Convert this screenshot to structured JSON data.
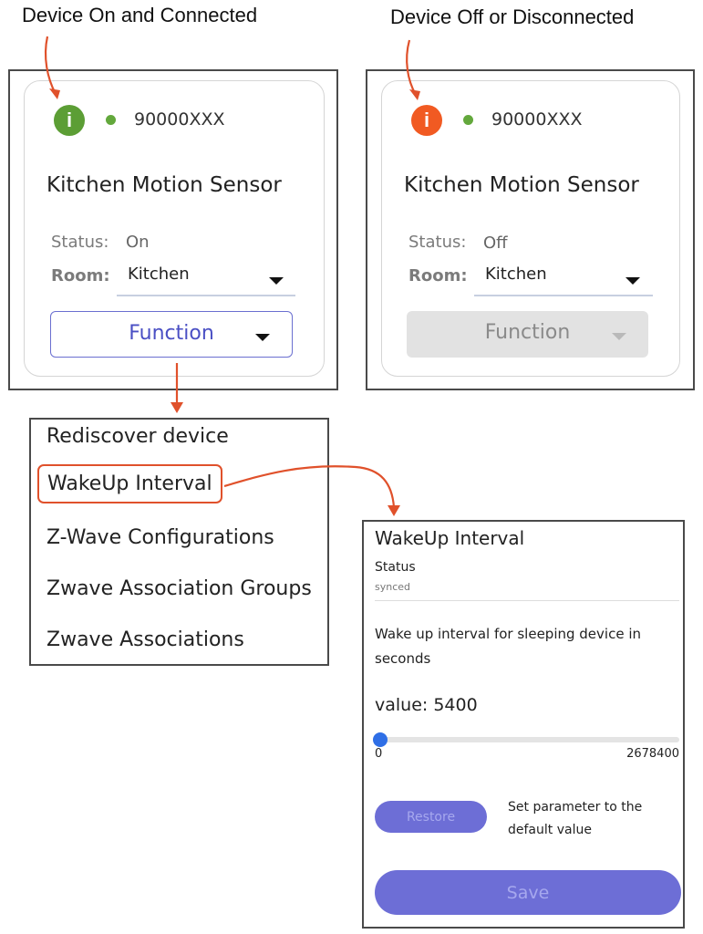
{
  "captions": {
    "left": "Device On and Connected",
    "right": "Device Off or Disconnected"
  },
  "card_on": {
    "info_icon": "info-icon",
    "info_glyph": "i",
    "icon_color": "#5c9e35",
    "connection_dot_color": "#63a83c",
    "device_id": "90000XXX",
    "device_name": "Kitchen Motion Sensor",
    "status_label": "Status:",
    "status_value": "On",
    "room_label": "Room:",
    "room_value": "Kitchen",
    "function_label": "Function"
  },
  "card_off": {
    "info_icon": "info-icon",
    "info_glyph": "i",
    "icon_color": "#f15a22",
    "connection_dot_color": "#63a83c",
    "device_id": "90000XXX",
    "device_name": "Kitchen Motion Sensor",
    "status_label": "Status:",
    "status_value": "Off",
    "room_label": "Room:",
    "room_value": "Kitchen",
    "function_label": "Function"
  },
  "function_menu": {
    "items": [
      "Rediscover device",
      "WakeUp Interval",
      "Z-Wave Configurations",
      "Zwave Association Groups",
      "Zwave Associations"
    ],
    "highlighted_index": 1
  },
  "wakeup_dialog": {
    "title": "WakeUp Interval",
    "status_label": "Status",
    "status_value": "synced",
    "description_line1": "Wake up interval for sleeping device in",
    "description_line2": "seconds",
    "value_text": "value: 5400",
    "slider": {
      "min": 0,
      "max": 2678400,
      "value": 5400,
      "min_label": "0",
      "max_label": "2678400"
    },
    "restore_label": "Restore",
    "restore_hint_line1": "Set parameter to the",
    "restore_hint_line2": "default value",
    "save_label": "Save"
  },
  "colors": {
    "annotation_arrow": "#e0512b",
    "accent": "#6d6ed6",
    "function_active_text": "#4a4fc4",
    "function_active_border": "#6a6fd0",
    "disabled_bg": "#e2e2e2",
    "disabled_text": "#8a8a8a"
  }
}
